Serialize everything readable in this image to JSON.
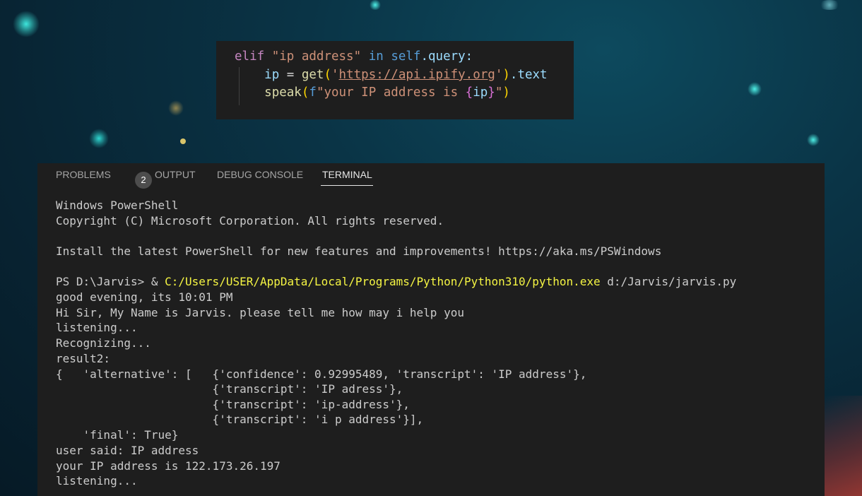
{
  "code_snippet": {
    "line1": {
      "kw": "elif",
      "str": "\"ip address\"",
      "in": "in",
      "self": "self",
      "rest": ".query:"
    },
    "line2": {
      "var": "ip",
      "eq": " = ",
      "fn": "get",
      "open": "(",
      "q1": "'",
      "url": "https://api.ipify.org",
      "q2": "'",
      "close": ")",
      "attr": ".text"
    },
    "line3": {
      "fn": "speak",
      "open": "(",
      "prefix": "f",
      "str_start": "\"your IP address is ",
      "brace_open": "{",
      "var": "ip",
      "brace_close": "}",
      "str_end": "\"",
      "close": ")"
    }
  },
  "panel": {
    "tabs": [
      {
        "label": "PROBLEMS",
        "badge": "2"
      },
      {
        "label": "OUTPUT"
      },
      {
        "label": "DEBUG CONSOLE"
      },
      {
        "label": "TERMINAL",
        "active": true
      }
    ]
  },
  "terminal": {
    "lines": [
      "Windows PowerShell",
      "Copyright (C) Microsoft Corporation. All rights reserved.",
      "",
      "Install the latest PowerShell for new features and improvements! https://aka.ms/PSWindows",
      "",
      "",
      "good evening, its 10:01 PM",
      "Hi Sir, My Name is Jarvis. please tell me how may i help you",
      "listening...",
      "Recognizing...",
      "result2:",
      "{   'alternative': [   {'confidence': 0.92995489, 'transcript': 'IP address'},",
      "                       {'transcript': 'IP adress'},",
      "                       {'transcript': 'ip-address'},",
      "                       {'transcript': 'i p address'}],",
      "    'final': True}",
      "user said: IP address",
      "your IP address is 122.173.26.197",
      "listening..."
    ],
    "prompt": {
      "ps": "PS D:\\Jarvis> & ",
      "exe": "C:/Users/USER/AppData/Local/Programs/Python/Python310/python.exe",
      "arg": " d:/Jarvis/jarvis.py"
    }
  },
  "colors": {
    "background": "#082433",
    "panel": "#1e1e1e",
    "highlight": "#f5f543",
    "dot": "#3ee6dc"
  }
}
